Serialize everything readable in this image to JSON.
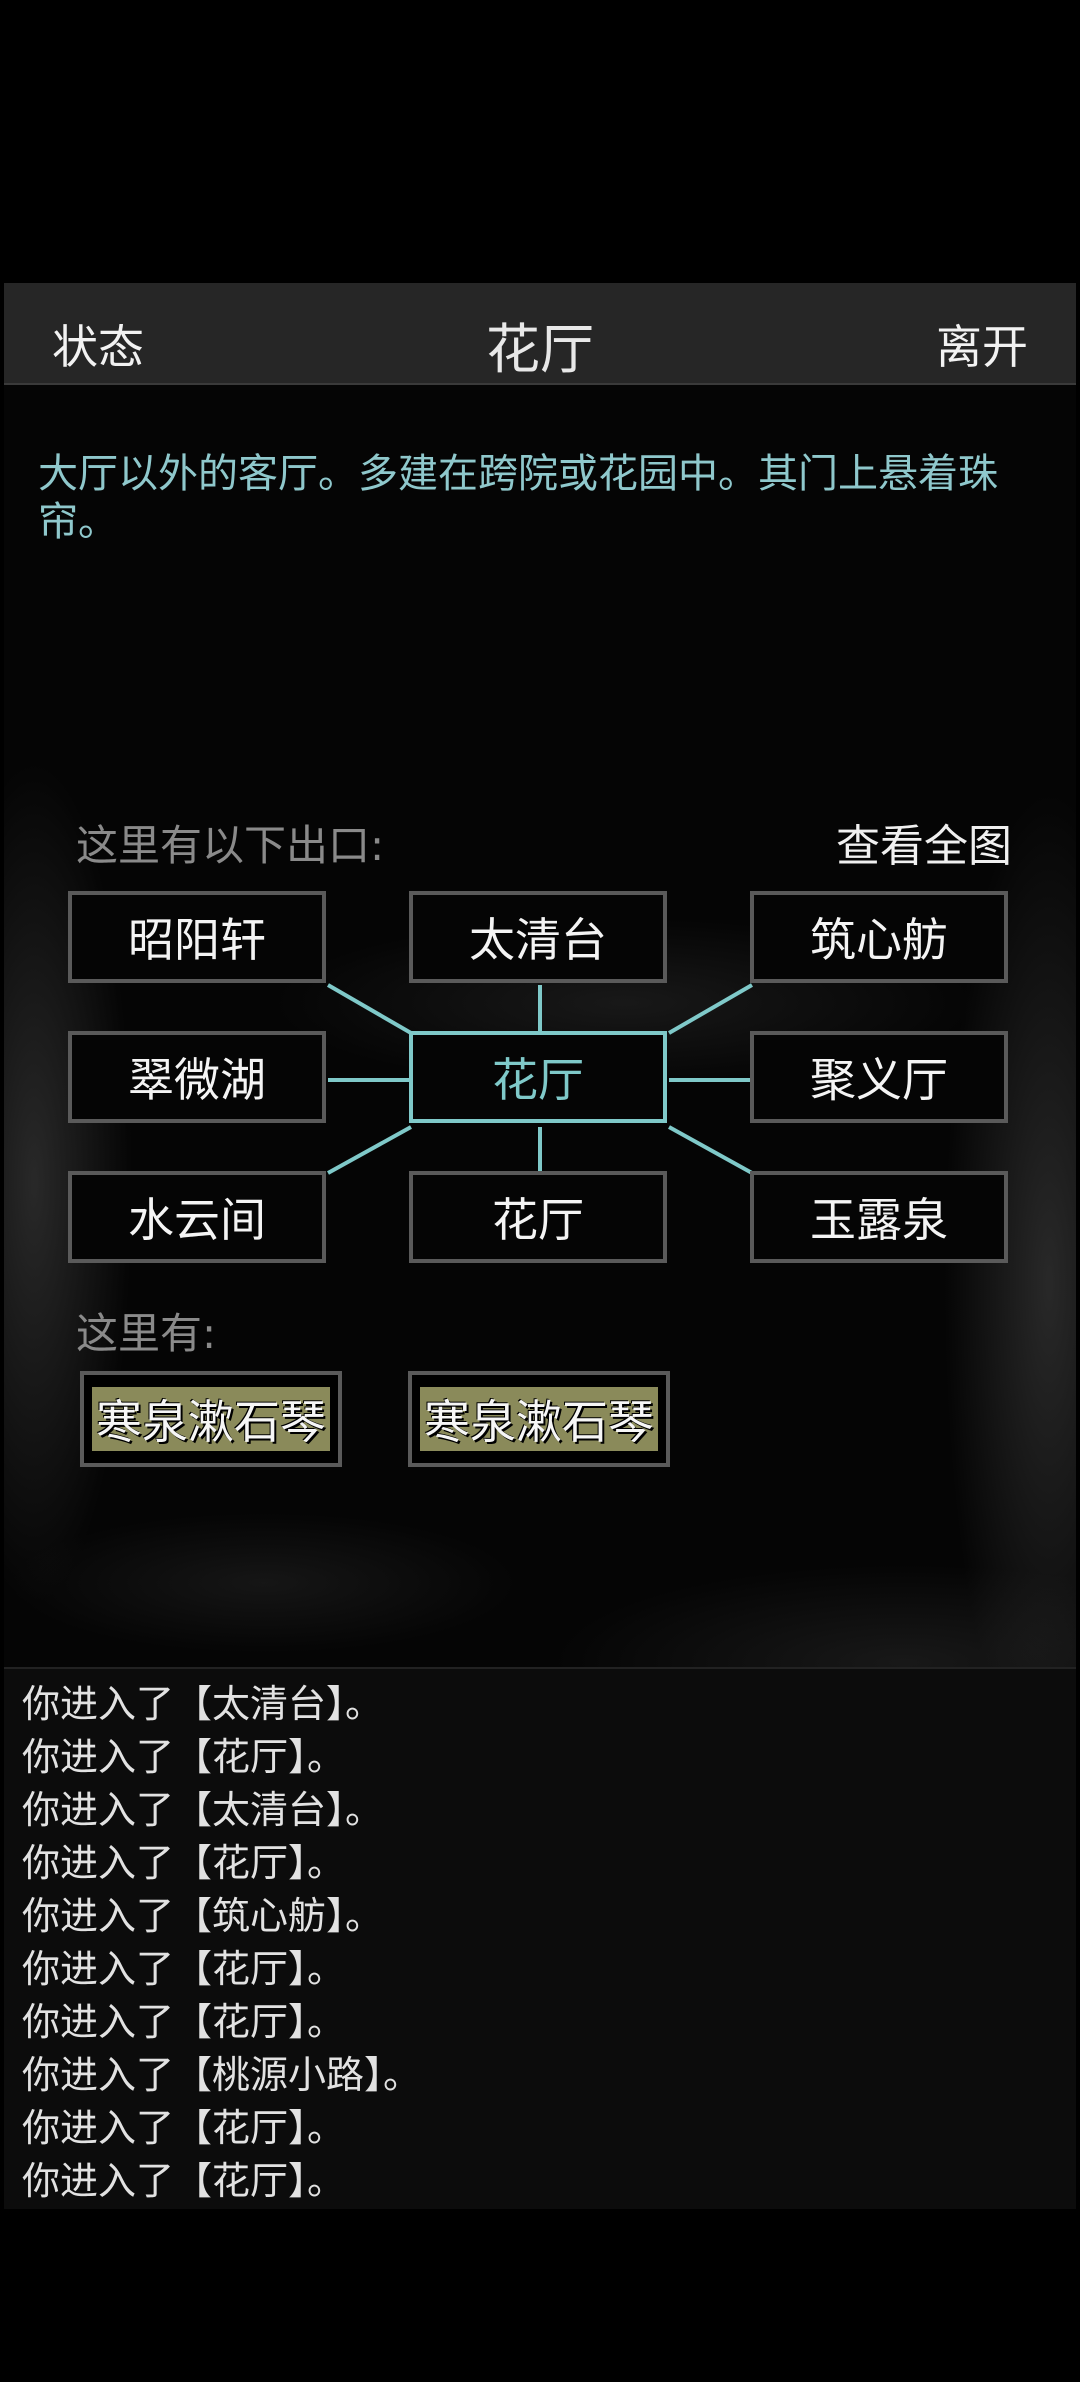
{
  "topbar": {
    "status_label": "状态",
    "title": "花厅",
    "leave_label": "离开"
  },
  "description": "大厅以外的客厅。多建在跨院或花园中。其门上悬着珠帘。",
  "exits": {
    "label": "这里有以下出口:",
    "map_label": "查看全图",
    "rooms": {
      "nw": "昭阳轩",
      "n": "太清台",
      "ne": "筑心舫",
      "w": "翠微湖",
      "center": "花厅",
      "e": "聚义厅",
      "sw": "水云间",
      "s": "花厅",
      "se": "玉露泉"
    }
  },
  "here": {
    "label": "这里有:",
    "items": [
      "寒泉漱石琴",
      "寒泉漱石琴"
    ]
  },
  "log": [
    "你进入了【太清台】。",
    "你进入了【花厅】。",
    "你进入了【太清台】。",
    "你进入了【花厅】。",
    "你进入了【筑心舫】。",
    "你进入了【花厅】。",
    "你进入了【花厅】。",
    "你进入了【桃源小路】。",
    "你进入了【花厅】。",
    "你进入了【花厅】。"
  ],
  "colors": {
    "accent": "#7fc9c9",
    "item_bg": "#8a8a5a",
    "description": "#8fc8cc"
  }
}
